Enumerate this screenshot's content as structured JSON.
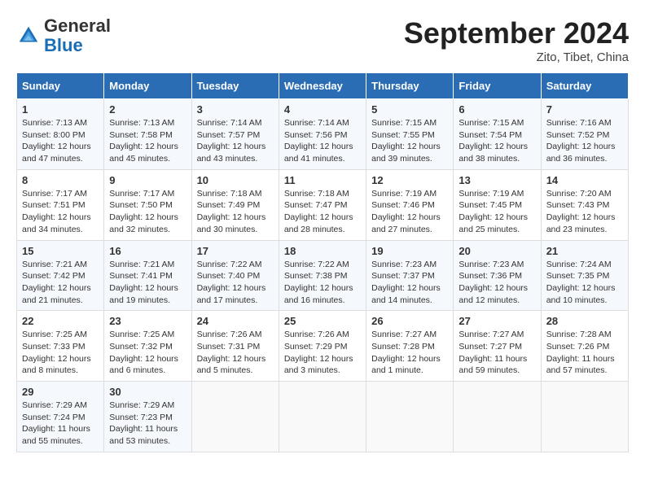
{
  "header": {
    "logo_general": "General",
    "logo_blue": "Blue",
    "month_title": "September 2024",
    "location": "Zito, Tibet, China"
  },
  "days_of_week": [
    "Sunday",
    "Monday",
    "Tuesday",
    "Wednesday",
    "Thursday",
    "Friday",
    "Saturday"
  ],
  "weeks": [
    [
      {
        "day": "1",
        "lines": [
          "Sunrise: 7:13 AM",
          "Sunset: 8:00 PM",
          "Daylight: 12 hours",
          "and 47 minutes."
        ]
      },
      {
        "day": "2",
        "lines": [
          "Sunrise: 7:13 AM",
          "Sunset: 7:58 PM",
          "Daylight: 12 hours",
          "and 45 minutes."
        ]
      },
      {
        "day": "3",
        "lines": [
          "Sunrise: 7:14 AM",
          "Sunset: 7:57 PM",
          "Daylight: 12 hours",
          "and 43 minutes."
        ]
      },
      {
        "day": "4",
        "lines": [
          "Sunrise: 7:14 AM",
          "Sunset: 7:56 PM",
          "Daylight: 12 hours",
          "and 41 minutes."
        ]
      },
      {
        "day": "5",
        "lines": [
          "Sunrise: 7:15 AM",
          "Sunset: 7:55 PM",
          "Daylight: 12 hours",
          "and 39 minutes."
        ]
      },
      {
        "day": "6",
        "lines": [
          "Sunrise: 7:15 AM",
          "Sunset: 7:54 PM",
          "Daylight: 12 hours",
          "and 38 minutes."
        ]
      },
      {
        "day": "7",
        "lines": [
          "Sunrise: 7:16 AM",
          "Sunset: 7:52 PM",
          "Daylight: 12 hours",
          "and 36 minutes."
        ]
      }
    ],
    [
      {
        "day": "8",
        "lines": [
          "Sunrise: 7:17 AM",
          "Sunset: 7:51 PM",
          "Daylight: 12 hours",
          "and 34 minutes."
        ]
      },
      {
        "day": "9",
        "lines": [
          "Sunrise: 7:17 AM",
          "Sunset: 7:50 PM",
          "Daylight: 12 hours",
          "and 32 minutes."
        ]
      },
      {
        "day": "10",
        "lines": [
          "Sunrise: 7:18 AM",
          "Sunset: 7:49 PM",
          "Daylight: 12 hours",
          "and 30 minutes."
        ]
      },
      {
        "day": "11",
        "lines": [
          "Sunrise: 7:18 AM",
          "Sunset: 7:47 PM",
          "Daylight: 12 hours",
          "and 28 minutes."
        ]
      },
      {
        "day": "12",
        "lines": [
          "Sunrise: 7:19 AM",
          "Sunset: 7:46 PM",
          "Daylight: 12 hours",
          "and 27 minutes."
        ]
      },
      {
        "day": "13",
        "lines": [
          "Sunrise: 7:19 AM",
          "Sunset: 7:45 PM",
          "Daylight: 12 hours",
          "and 25 minutes."
        ]
      },
      {
        "day": "14",
        "lines": [
          "Sunrise: 7:20 AM",
          "Sunset: 7:43 PM",
          "Daylight: 12 hours",
          "and 23 minutes."
        ]
      }
    ],
    [
      {
        "day": "15",
        "lines": [
          "Sunrise: 7:21 AM",
          "Sunset: 7:42 PM",
          "Daylight: 12 hours",
          "and 21 minutes."
        ]
      },
      {
        "day": "16",
        "lines": [
          "Sunrise: 7:21 AM",
          "Sunset: 7:41 PM",
          "Daylight: 12 hours",
          "and 19 minutes."
        ]
      },
      {
        "day": "17",
        "lines": [
          "Sunrise: 7:22 AM",
          "Sunset: 7:40 PM",
          "Daylight: 12 hours",
          "and 17 minutes."
        ]
      },
      {
        "day": "18",
        "lines": [
          "Sunrise: 7:22 AM",
          "Sunset: 7:38 PM",
          "Daylight: 12 hours",
          "and 16 minutes."
        ]
      },
      {
        "day": "19",
        "lines": [
          "Sunrise: 7:23 AM",
          "Sunset: 7:37 PM",
          "Daylight: 12 hours",
          "and 14 minutes."
        ]
      },
      {
        "day": "20",
        "lines": [
          "Sunrise: 7:23 AM",
          "Sunset: 7:36 PM",
          "Daylight: 12 hours",
          "and 12 minutes."
        ]
      },
      {
        "day": "21",
        "lines": [
          "Sunrise: 7:24 AM",
          "Sunset: 7:35 PM",
          "Daylight: 12 hours",
          "and 10 minutes."
        ]
      }
    ],
    [
      {
        "day": "22",
        "lines": [
          "Sunrise: 7:25 AM",
          "Sunset: 7:33 PM",
          "Daylight: 12 hours",
          "and 8 minutes."
        ]
      },
      {
        "day": "23",
        "lines": [
          "Sunrise: 7:25 AM",
          "Sunset: 7:32 PM",
          "Daylight: 12 hours",
          "and 6 minutes."
        ]
      },
      {
        "day": "24",
        "lines": [
          "Sunrise: 7:26 AM",
          "Sunset: 7:31 PM",
          "Daylight: 12 hours",
          "and 5 minutes."
        ]
      },
      {
        "day": "25",
        "lines": [
          "Sunrise: 7:26 AM",
          "Sunset: 7:29 PM",
          "Daylight: 12 hours",
          "and 3 minutes."
        ]
      },
      {
        "day": "26",
        "lines": [
          "Sunrise: 7:27 AM",
          "Sunset: 7:28 PM",
          "Daylight: 12 hours",
          "and 1 minute."
        ]
      },
      {
        "day": "27",
        "lines": [
          "Sunrise: 7:27 AM",
          "Sunset: 7:27 PM",
          "Daylight: 11 hours",
          "and 59 minutes."
        ]
      },
      {
        "day": "28",
        "lines": [
          "Sunrise: 7:28 AM",
          "Sunset: 7:26 PM",
          "Daylight: 11 hours",
          "and 57 minutes."
        ]
      }
    ],
    [
      {
        "day": "29",
        "lines": [
          "Sunrise: 7:29 AM",
          "Sunset: 7:24 PM",
          "Daylight: 11 hours",
          "and 55 minutes."
        ]
      },
      {
        "day": "30",
        "lines": [
          "Sunrise: 7:29 AM",
          "Sunset: 7:23 PM",
          "Daylight: 11 hours",
          "and 53 minutes."
        ]
      },
      null,
      null,
      null,
      null,
      null
    ]
  ]
}
